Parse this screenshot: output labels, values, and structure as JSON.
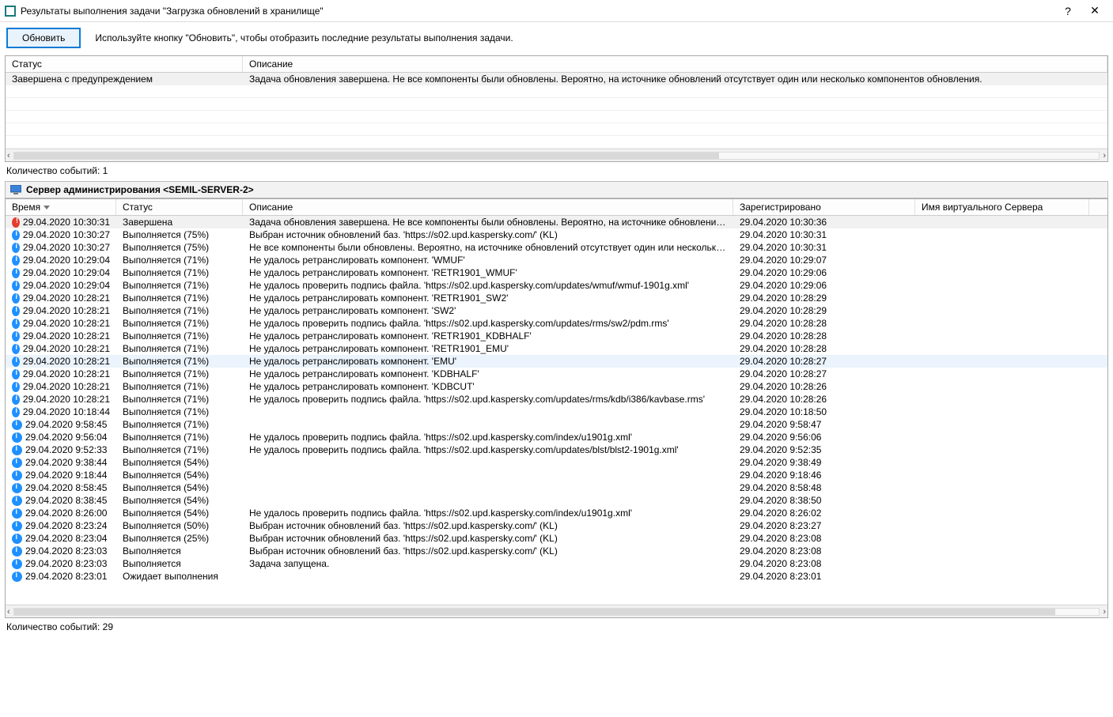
{
  "window": {
    "title": "Результаты выполнения задачи \"Загрузка обновлений в хранилище\""
  },
  "toolbar": {
    "refresh_label": "Обновить",
    "tip": "Используйте кнопку \"Обновить\", чтобы отобразить последние результаты выполнения задачи."
  },
  "top_grid": {
    "columns": {
      "status": "Статус",
      "descr": "Описание"
    },
    "rows": [
      {
        "status": "Завершена с предупреждением",
        "descr": "Задача обновления завершена. Не все компоненты были обновлены. Вероятно, на источнике обновлений отсутствует один или несколько компонентов обновления."
      }
    ],
    "count_label": "Количество событий: 1"
  },
  "server_header": {
    "label": "Сервер администрирования <SEMIL-SERVER-2>"
  },
  "btm_grid": {
    "columns": {
      "time": "Время",
      "status": "Статус",
      "descr": "Описание",
      "registered": "Зарегистрировано",
      "vserver": "Имя виртуального Сервера"
    },
    "rows": [
      {
        "icon": "warn",
        "time": "29.04.2020 10:30:31",
        "status": "Завершена",
        "descr": "Задача обновления завершена. Не все компоненты были обновлены. Вероятно, на источнике обновлений отсутствует...",
        "reg": "29.04.2020 10:30:36",
        "sel": "highlight"
      },
      {
        "icon": "info",
        "time": "29.04.2020 10:30:27",
        "status": "Выполняется (75%)",
        "descr": "Выбран источник обновлений баз. 'https://s02.upd.kaspersky.com/' (KL)",
        "reg": "29.04.2020 10:30:31"
      },
      {
        "icon": "info",
        "time": "29.04.2020 10:30:27",
        "status": "Выполняется (75%)",
        "descr": "Не все компоненты были обновлены. Вероятно, на источнике обновлений отсутствует один или несколько компонент...",
        "reg": "29.04.2020 10:30:31"
      },
      {
        "icon": "info",
        "time": "29.04.2020 10:29:04",
        "status": "Выполняется (71%)",
        "descr": "Не удалось ретранслировать компонент. 'WMUF'",
        "reg": "29.04.2020 10:29:07"
      },
      {
        "icon": "info",
        "time": "29.04.2020 10:29:04",
        "status": "Выполняется (71%)",
        "descr": "Не удалось ретранслировать компонент. 'RETR1901_WMUF'",
        "reg": "29.04.2020 10:29:06"
      },
      {
        "icon": "info",
        "time": "29.04.2020 10:29:04",
        "status": "Выполняется (71%)",
        "descr": "Не удалось проверить подпись файла. 'https://s02.upd.kaspersky.com/updates/wmuf/wmuf-1901g.xml'",
        "reg": "29.04.2020 10:29:06"
      },
      {
        "icon": "info",
        "time": "29.04.2020 10:28:21",
        "status": "Выполняется (71%)",
        "descr": "Не удалось ретранслировать компонент. 'RETR1901_SW2'",
        "reg": "29.04.2020 10:28:29"
      },
      {
        "icon": "info",
        "time": "29.04.2020 10:28:21",
        "status": "Выполняется (71%)",
        "descr": "Не удалось ретранслировать компонент. 'SW2'",
        "reg": "29.04.2020 10:28:29"
      },
      {
        "icon": "info",
        "time": "29.04.2020 10:28:21",
        "status": "Выполняется (71%)",
        "descr": "Не удалось проверить подпись файла. 'https://s02.upd.kaspersky.com/updates/rms/sw2/pdm.rms'",
        "reg": "29.04.2020 10:28:28"
      },
      {
        "icon": "info",
        "time": "29.04.2020 10:28:21",
        "status": "Выполняется (71%)",
        "descr": "Не удалось ретранслировать компонент. 'RETR1901_KDBHALF'",
        "reg": "29.04.2020 10:28:28"
      },
      {
        "icon": "info",
        "time": "29.04.2020 10:28:21",
        "status": "Выполняется (71%)",
        "descr": "Не удалось ретранслировать компонент. 'RETR1901_EMU'",
        "reg": "29.04.2020 10:28:28"
      },
      {
        "icon": "info",
        "time": "29.04.2020 10:28:21",
        "status": "Выполняется (71%)",
        "descr": "Не удалось ретранслировать компонент. 'EMU'",
        "reg": "29.04.2020 10:28:27",
        "sel": "selected"
      },
      {
        "icon": "info",
        "time": "29.04.2020 10:28:21",
        "status": "Выполняется (71%)",
        "descr": "Не удалось ретранслировать компонент. 'KDBHALF'",
        "reg": "29.04.2020 10:28:27"
      },
      {
        "icon": "info",
        "time": "29.04.2020 10:28:21",
        "status": "Выполняется (71%)",
        "descr": "Не удалось ретранслировать компонент. 'KDBCUT'",
        "reg": "29.04.2020 10:28:26"
      },
      {
        "icon": "info",
        "time": "29.04.2020 10:28:21",
        "status": "Выполняется (71%)",
        "descr": "Не удалось проверить подпись файла. 'https://s02.upd.kaspersky.com/updates/rms/kdb/i386/kavbase.rms'",
        "reg": "29.04.2020 10:28:26"
      },
      {
        "icon": "info",
        "time": "29.04.2020 10:18:44",
        "status": "Выполняется (71%)",
        "descr": "",
        "reg": "29.04.2020 10:18:50"
      },
      {
        "icon": "info",
        "time": "29.04.2020 9:58:45",
        "status": "Выполняется (71%)",
        "descr": "",
        "reg": "29.04.2020 9:58:47"
      },
      {
        "icon": "info",
        "time": "29.04.2020 9:56:04",
        "status": "Выполняется (71%)",
        "descr": "Не удалось проверить подпись файла. 'https://s02.upd.kaspersky.com/index/u1901g.xml'",
        "reg": "29.04.2020 9:56:06"
      },
      {
        "icon": "info",
        "time": "29.04.2020 9:52:33",
        "status": "Выполняется (71%)",
        "descr": "Не удалось проверить подпись файла. 'https://s02.upd.kaspersky.com/updates/blst/blst2-1901g.xml'",
        "reg": "29.04.2020 9:52:35"
      },
      {
        "icon": "info",
        "time": "29.04.2020 9:38:44",
        "status": "Выполняется (54%)",
        "descr": "",
        "reg": "29.04.2020 9:38:49"
      },
      {
        "icon": "info",
        "time": "29.04.2020 9:18:44",
        "status": "Выполняется (54%)",
        "descr": "",
        "reg": "29.04.2020 9:18:46"
      },
      {
        "icon": "info",
        "time": "29.04.2020 8:58:45",
        "status": "Выполняется (54%)",
        "descr": "",
        "reg": "29.04.2020 8:58:48"
      },
      {
        "icon": "info",
        "time": "29.04.2020 8:38:45",
        "status": "Выполняется (54%)",
        "descr": "",
        "reg": "29.04.2020 8:38:50"
      },
      {
        "icon": "info",
        "time": "29.04.2020 8:26:00",
        "status": "Выполняется (54%)",
        "descr": "Не удалось проверить подпись файла. 'https://s02.upd.kaspersky.com/index/u1901g.xml'",
        "reg": "29.04.2020 8:26:02"
      },
      {
        "icon": "info",
        "time": "29.04.2020 8:23:24",
        "status": "Выполняется (50%)",
        "descr": "Выбран источник обновлений баз. 'https://s02.upd.kaspersky.com/' (KL)",
        "reg": "29.04.2020 8:23:27"
      },
      {
        "icon": "info",
        "time": "29.04.2020 8:23:04",
        "status": "Выполняется (25%)",
        "descr": "Выбран источник обновлений баз. 'https://s02.upd.kaspersky.com/' (KL)",
        "reg": "29.04.2020 8:23:08"
      },
      {
        "icon": "info",
        "time": "29.04.2020 8:23:03",
        "status": "Выполняется",
        "descr": "Выбран источник обновлений баз. 'https://s02.upd.kaspersky.com/' (KL)",
        "reg": "29.04.2020 8:23:08"
      },
      {
        "icon": "info",
        "time": "29.04.2020 8:23:03",
        "status": "Выполняется",
        "descr": "Задача запущена.",
        "reg": "29.04.2020 8:23:08"
      },
      {
        "icon": "info",
        "time": "29.04.2020 8:23:01",
        "status": "Ожидает выполнения",
        "descr": "",
        "reg": "29.04.2020 8:23:01"
      }
    ],
    "count_label": "Количество событий: 29"
  }
}
